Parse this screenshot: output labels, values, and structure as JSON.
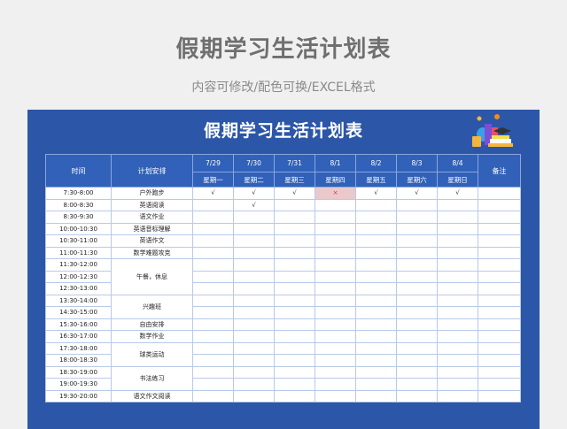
{
  "heading": {
    "title": "假期学习生活计划表",
    "subtitle": "内容可修改/配色可换/EXCEL格式"
  },
  "sheet": {
    "title": "假期学习生活计划表",
    "illustration_icon": "books-icon"
  },
  "table": {
    "col_time": "时间",
    "col_plan": "计划安排",
    "col_note": "备注",
    "dates": [
      "7/29",
      "7/30",
      "7/31",
      "8/1",
      "8/2",
      "8/3",
      "8/4"
    ],
    "weekdays": [
      "星期一",
      "星期二",
      "星期三",
      "星期四",
      "星期五",
      "星期六",
      "星期日"
    ],
    "times": [
      "7:30-8:00",
      "8:00-8:30",
      "8:30-9:30",
      "10:00-10:30",
      "10:30-11:00",
      "11:00-11:30",
      "11:30-12:00",
      "12:00-12:30",
      "12:30-13:00",
      "13:30-14:00",
      "14:30-15:00",
      "15:30-16:00",
      "16:30-17:00",
      "17:30-18:00",
      "18:00-18:30",
      "18:30-19:00",
      "19:00-19:30",
      "19:30-20:00"
    ],
    "plans": [
      "户外跑步",
      "英语阅读",
      "语文作业",
      "英语音标理解",
      "英语作文",
      "数学难题攻克",
      "午餐，休息",
      "兴趣班",
      "自由安排",
      "数学作业",
      "球类运动",
      "书法练习",
      "语文作文阅读"
    ],
    "marks": {
      "check": "√",
      "cross": "×"
    },
    "row0_marks": [
      "√",
      "√",
      "√",
      "×",
      "√",
      "√",
      "√"
    ],
    "row1_marks": [
      "",
      "√",
      "",
      "",
      "",
      "",
      ""
    ]
  },
  "colors": {
    "sheet_bg": "#2c57a8",
    "header_bg": "#3161b8",
    "cross_cell_bg": "#e9c9cc"
  }
}
